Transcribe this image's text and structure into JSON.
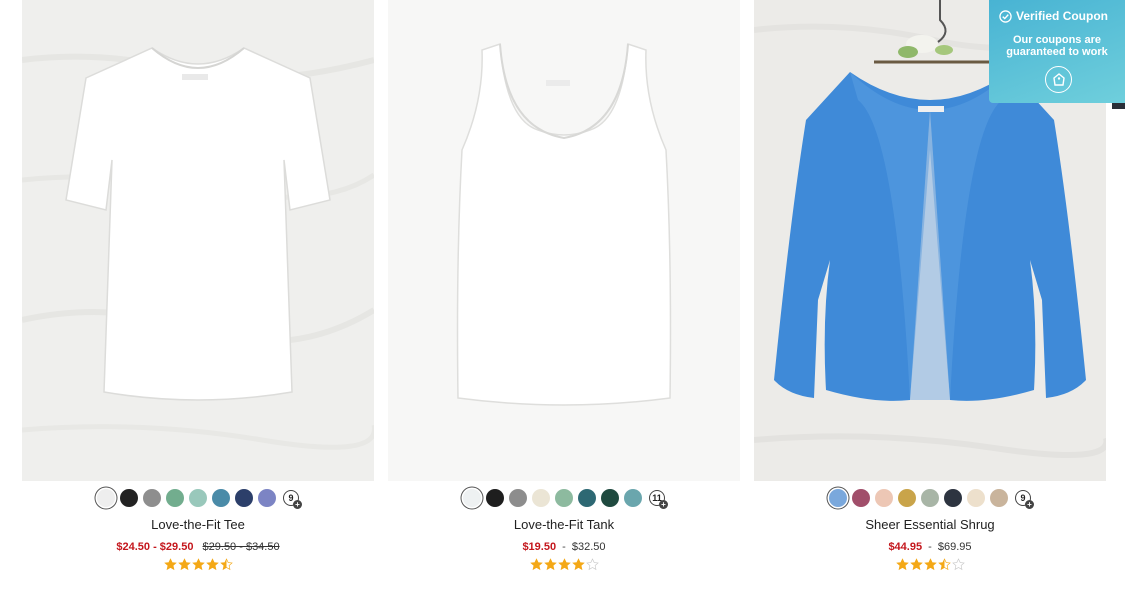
{
  "products": [
    {
      "name": "Love-the-Fit Tee",
      "image_alt": "white short sleeve tee",
      "swatches": [
        "#eeeeee",
        "#222222",
        "#8e8e8e",
        "#72ad8e",
        "#99c8bb",
        "#4a8ba8",
        "#2c3f6a",
        "#7c84c4"
      ],
      "more_count": "9",
      "sale_price": "$24.50 - $29.50",
      "original_price": "$29.50 - $34.50",
      "regular_price": "",
      "rating": 4.5
    },
    {
      "name": "Love-the-Fit Tank",
      "image_alt": "white tank top",
      "swatches": [
        "#eef1f2",
        "#1e1e1e",
        "#8d8d8d",
        "#ebe5d5",
        "#8dba9f",
        "#2d6873",
        "#1f4a3f",
        "#6aa6ad"
      ],
      "more_count": "11",
      "sale_price": "$19.50",
      "original_price": "",
      "regular_price": "$32.50",
      "rating": 4
    },
    {
      "name": "Sheer Essential Shrug",
      "image_alt": "blue sheer shrug on hanger",
      "swatches": [
        "#7aa8dc",
        "#a14e6a",
        "#edc7b5",
        "#c9a44a",
        "#a8b5a6",
        "#2d3440",
        "#ede0cc",
        "#c9b49c"
      ],
      "more_count": "9",
      "sale_price": "$44.95",
      "original_price": "",
      "regular_price": "$69.95",
      "rating": 3.5
    }
  ],
  "coupon": {
    "title": "Verified Coupon",
    "subtitle": "Our coupons are guaranteed to work"
  },
  "colors": {
    "sale": "#c4161c",
    "star": "#f4a816",
    "coupon_bg": "#4ab5d4",
    "shrug_blue": "#3f8ad8"
  }
}
